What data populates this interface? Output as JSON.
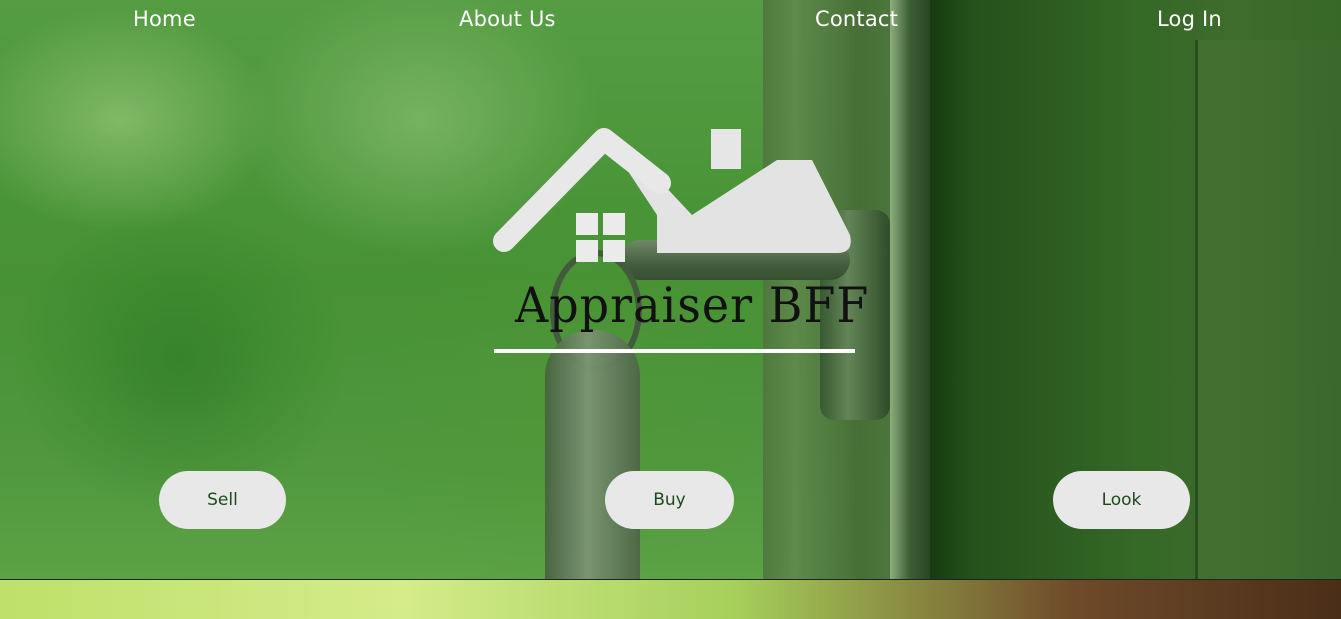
{
  "nav": {
    "home": "Home",
    "about": "About Us",
    "contact": "Contact",
    "login": "Log In"
  },
  "logo": {
    "text": "Appraiser BFF"
  },
  "actions": {
    "sell": "Sell",
    "buy": "Buy",
    "look": "Look"
  },
  "colors": {
    "button_bg": "#e8e8e8",
    "button_text": "#1d4a1d",
    "nav_text": "#ffffff",
    "logo_house": "#e6e6e6"
  }
}
